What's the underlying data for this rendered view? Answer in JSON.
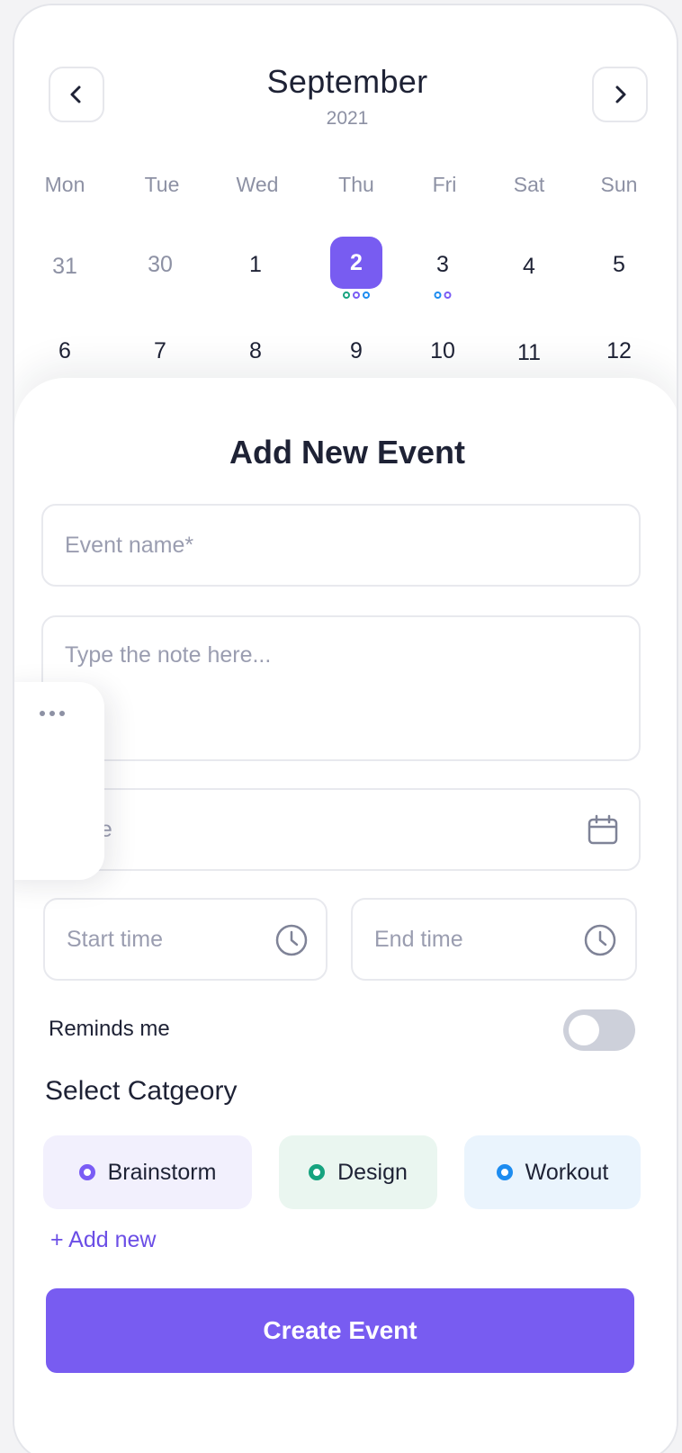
{
  "calendar": {
    "month": "September",
    "year": "2021",
    "weekdays": [
      "Mon",
      "Tue",
      "Wed",
      "Thu",
      "Fri",
      "Sat",
      "Sun"
    ],
    "week1": [
      "31",
      "30",
      "1",
      "2",
      "3",
      "4",
      "5"
    ],
    "week2": [
      "6",
      "7",
      "8",
      "9",
      "10",
      "11",
      "12"
    ],
    "selected_day": "2",
    "event_dot_colors": {
      "thu_2": [
        "#16a37f",
        "#7a5cf5",
        "#1d8cf0"
      ],
      "fri_3": [
        "#1d8cf0",
        "#7a5cf5"
      ]
    }
  },
  "sheet": {
    "title": "Add New Event",
    "event_name_placeholder": "Event name*",
    "note_placeholder": "Type the note here...",
    "date_placeholder": "Date",
    "start_time_placeholder": "Start time",
    "end_time_placeholder": "End time",
    "reminds_label": "Reminds me",
    "reminds_on": false,
    "category_title": "Select Catgeory",
    "categories": [
      {
        "label": "Brainstorm",
        "color": "#7a5cf5",
        "bg": "#f2f0fd"
      },
      {
        "label": "Design",
        "color": "#16a37f",
        "bg": "#eaf6f0"
      },
      {
        "label": "Workout",
        "color": "#1d8cf0",
        "bg": "#eaf4fd"
      }
    ],
    "add_new_label": "+ Add new",
    "create_button_label": "Create Event"
  },
  "colors": {
    "accent": "#785cf1",
    "text": "#1e2235",
    "muted": "#8d91a4"
  }
}
